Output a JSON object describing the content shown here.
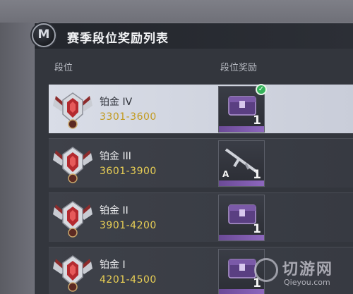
{
  "panel": {
    "logo_letter": "M",
    "title": "赛季段位奖励列表"
  },
  "columns": {
    "rank": "段位",
    "reward": "段位奖励"
  },
  "ranks": [
    {
      "name": "铂金 IV",
      "range": "3301-3600",
      "reward_icon": "crate-icon",
      "reward_count": "1",
      "reward_letter": "",
      "claimed": true,
      "selected": true
    },
    {
      "name": "铂金 III",
      "range": "3601-3900",
      "reward_icon": "rifle-icon",
      "reward_count": "1",
      "reward_letter": "A",
      "claimed": false,
      "selected": false
    },
    {
      "name": "铂金 II",
      "range": "3901-4200",
      "reward_icon": "crate-icon",
      "reward_count": "1",
      "reward_letter": "",
      "claimed": false,
      "selected": false
    },
    {
      "name": "铂金 I",
      "range": "4201-4500",
      "reward_icon": "crate-icon",
      "reward_count": "1",
      "reward_letter": "",
      "claimed": false,
      "selected": false
    }
  ],
  "colors": {
    "range_text": "#e9cf55",
    "reward_strip": "#7a57ab",
    "claimed_check": "#35b35a"
  },
  "watermark": {
    "title": "切游网",
    "url": "Qieyou.com"
  }
}
